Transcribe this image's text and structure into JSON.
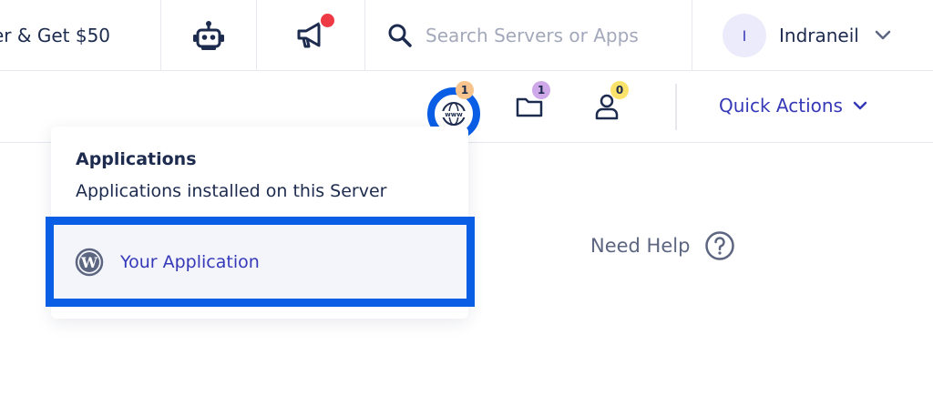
{
  "topbar": {
    "refer_text": "er & Get $50",
    "icons": {
      "robot": "robot-icon",
      "announcement": "megaphone-icon",
      "search": "search-icon",
      "chevron": "chevron-down-icon"
    },
    "search_placeholder": "Search Servers or Apps",
    "user": {
      "avatar_initial": "I",
      "name": "Indraneil"
    },
    "notification_color": "#ee3a44"
  },
  "subbar": {
    "badges": {
      "applications": "1",
      "folders": "1",
      "users": "0"
    },
    "icons": [
      "www-globe-icon",
      "folder-icon",
      "person-icon",
      "chevron-down-icon"
    ],
    "quick_actions_label": "Quick Actions"
  },
  "dropdown": {
    "title": "Applications",
    "subtitle": "Applications installed on this Server",
    "items": [
      {
        "label": "Your Application",
        "icon": "wordpress-icon"
      }
    ]
  },
  "help": {
    "label": "Need Help",
    "icon": "question-circle-icon"
  },
  "colors": {
    "accent": "#3539b8",
    "highlight": "#0a5ee6",
    "text": "#1d2b4f"
  }
}
